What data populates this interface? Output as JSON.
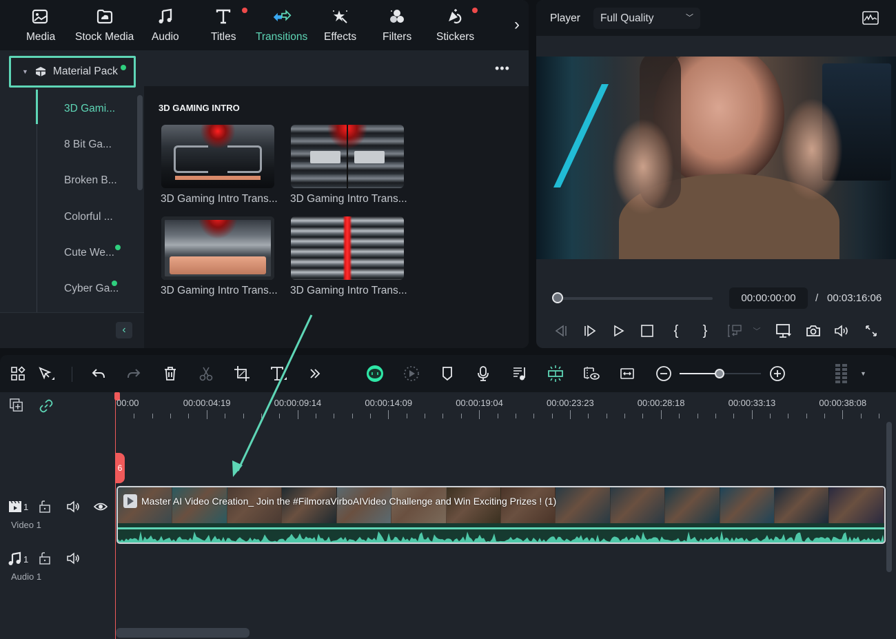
{
  "library": {
    "tabs": [
      {
        "label": "Media",
        "icon": "media-icon",
        "badge": false,
        "active": false
      },
      {
        "label": "Stock Media",
        "icon": "stock-media-icon",
        "badge": false,
        "active": false
      },
      {
        "label": "Audio",
        "icon": "music-note-icon",
        "badge": false,
        "active": false
      },
      {
        "label": "Titles",
        "icon": "titles-icon",
        "badge": true,
        "active": false
      },
      {
        "label": "Transitions",
        "icon": "transitions-icon",
        "badge": false,
        "active": true
      },
      {
        "label": "Effects",
        "icon": "effects-icon",
        "badge": false,
        "active": false
      },
      {
        "label": "Filters",
        "icon": "filters-icon",
        "badge": false,
        "active": false
      },
      {
        "label": "Stickers",
        "icon": "stickers-icon",
        "badge": true,
        "active": false
      }
    ],
    "next_icon": "›",
    "material_pack": {
      "label": "Material Pack",
      "badge": true
    },
    "categories": [
      {
        "label": "3D Gami...",
        "active": true,
        "badge": false
      },
      {
        "label": "8 Bit Ga...",
        "active": false,
        "badge": false
      },
      {
        "label": "Broken B...",
        "active": false,
        "badge": false
      },
      {
        "label": "Colorful ...",
        "active": false,
        "badge": false
      },
      {
        "label": "Cute We...",
        "active": false,
        "badge": true
      },
      {
        "label": "Cyber Ga...",
        "active": false,
        "badge": true
      }
    ],
    "collapse_icon": "‹",
    "more_icon": "•••",
    "section_title": "3D GAMING INTRO",
    "items": [
      {
        "caption": "3D Gaming Intro Trans..."
      },
      {
        "caption": "3D Gaming Intro Trans..."
      },
      {
        "caption": "3D Gaming Intro Trans..."
      },
      {
        "caption": "3D Gaming Intro Trans..."
      }
    ]
  },
  "player": {
    "label": "Player",
    "quality": "Full Quality",
    "current_time": "00:00:00:00",
    "separator": "/",
    "total_time": "00:03:16:06",
    "progress": 0,
    "controls": [
      {
        "name": "prev-frame-button",
        "glyph": "◁|"
      },
      {
        "name": "play-clip-button",
        "glyph": "|▷"
      },
      {
        "name": "play-button",
        "glyph": "▷"
      },
      {
        "name": "stop-button",
        "glyph": "□"
      },
      {
        "name": "mark-in-button",
        "glyph": "{"
      },
      {
        "name": "mark-out-button",
        "glyph": "}"
      }
    ]
  },
  "timeline": {
    "zoom_level": 0.5,
    "ruler_labels": [
      "00:00",
      "00:00:04:19",
      "00:00:09:14",
      "00:00:14:09",
      "00:00:19:04",
      "00:00:23:23",
      "00:00:28:18",
      "00:00:33:13",
      "00:00:38:08"
    ],
    "playhead_label": "6",
    "tracks": [
      {
        "type": "video",
        "number": "1",
        "name": "Video 1"
      },
      {
        "type": "audio",
        "number": "1",
        "name": "Audio 1"
      }
    ],
    "clip": {
      "title": "Master AI Video Creation_ Join the #FilmoraVirboAIVideo Challenge and Win Exciting Prizes ! (1)"
    }
  },
  "colors": {
    "accent": "#5ed6b6",
    "badge_red": "#ee4a4a",
    "badge_green": "#2fcf7e",
    "playhead": "#f05a5a"
  }
}
